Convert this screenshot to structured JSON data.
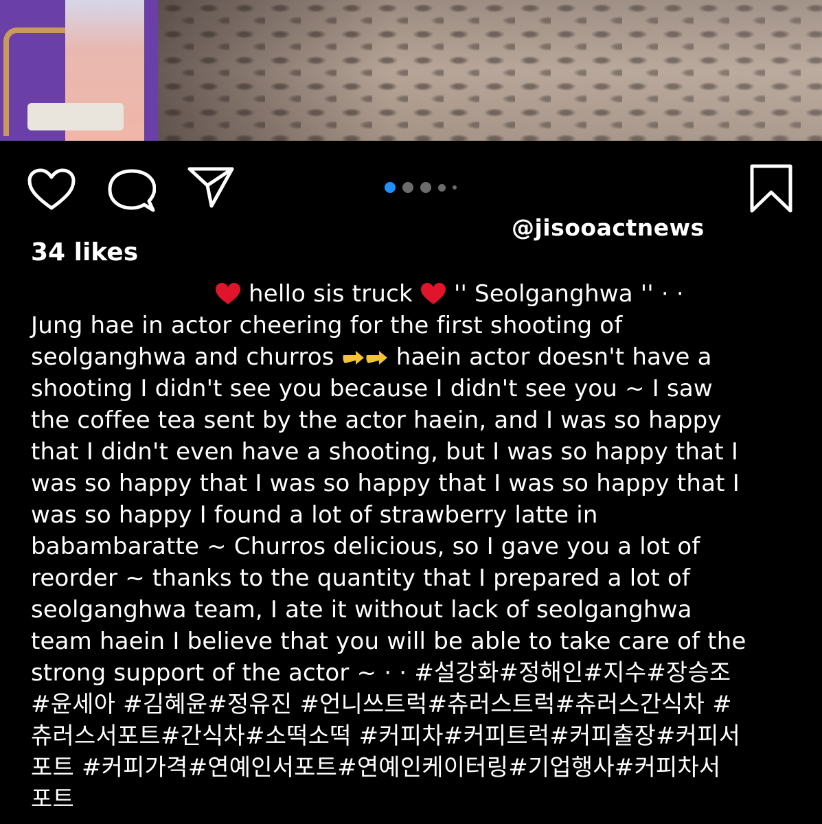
{
  "watermark": "@jisooactnews",
  "likes": "34 likes",
  "carousel": {
    "count": 5,
    "active_index": 0
  },
  "colors": {
    "background": "#000000",
    "active_dot": "#1e90ff",
    "inactive_dot": "#6c6c6c"
  },
  "icons": [
    "heart-icon",
    "comment-icon",
    "share-icon",
    "bookmark-icon"
  ],
  "caption": {
    "line1_a": "hello sis truck",
    "line1_b": "'' Seolganghwa ''  · ·",
    "line2": "Jung hae in actor cheering for the first shooting of",
    "line3_a": "seolganghwa and churros",
    "line3_b": "haein actor doesn't have a",
    "line4": "shooting I didn't see you because I didn't see you ~ I saw",
    "line5": "the coffee tea sent by the actor haein, and I was so happy",
    "line6": "that I didn't even have a shooting, but I was so happy that I",
    "line7": "was so happy that I was so happy that I was so happy that I",
    "line8": "was so happy I found a lot of strawberry latte in",
    "line9": "babambaratte ~ Churros delicious, so I gave you a lot of",
    "line10": "reorder ~ thanks to the quantity that I prepared a lot of",
    "line11": "seolganghwa team, I ate it without lack of seolganghwa",
    "line12": "team haein I believe that you will be able to take care of the",
    "line13": "strong support of the actor ~  · · #설강화#정해인#지수#장승조",
    "line14": "#윤세아 #김혜윤#정유진 #언니쓰트럭#츄러스트럭#츄러스간식차 #",
    "line15": "츄러스서포트#간식차#소떡소떡 #커피차#커피트럭#커피출장#커피서",
    "line16": "포트 #커피가격#연예인서포트#연예인케이터링#기업행사#커피차서",
    "line17": "포트"
  }
}
